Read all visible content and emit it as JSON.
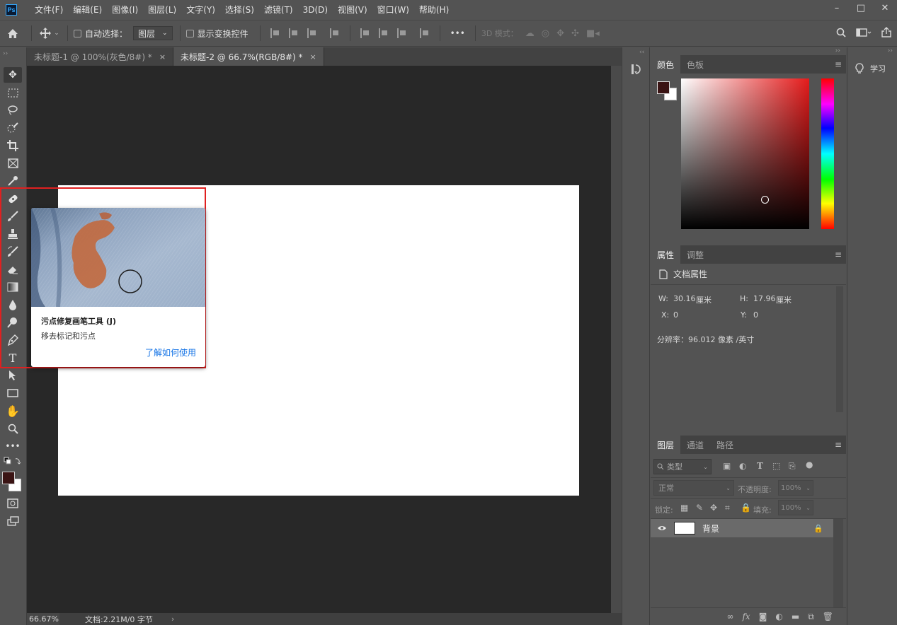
{
  "app": {
    "logo": "Ps",
    "menu": [
      "文件(F)",
      "编辑(E)",
      "图像(I)",
      "图层(L)",
      "文字(Y)",
      "选择(S)",
      "滤镜(T)",
      "3D(D)",
      "视图(V)",
      "窗口(W)",
      "帮助(H)"
    ],
    "window_buttons": [
      "–",
      "□",
      "✕"
    ]
  },
  "options_bar": {
    "auto_select_label": "自动选择：",
    "layer_dropdown": "图层",
    "show_transform_label": "显示变换控件",
    "more": "•••",
    "mode_3d_label": "3D 模式："
  },
  "tabs": [
    {
      "label": "未标题-1 @ 100%(灰色/8#) *",
      "close": "×"
    },
    {
      "label": "未标题-2 @ 66.7%(RGB/8#) *",
      "close": "×"
    }
  ],
  "toolbar": {
    "collapse": "››",
    "more": "•••"
  },
  "tooltip": {
    "title": "污点修复画笔工具 (J)",
    "description": "移去标记和污点",
    "link": "了解如何使用"
  },
  "status": {
    "zoom": "66.67%",
    "doc_info": "文档:2.21M/0 字节",
    "arrow": "›"
  },
  "color_panel": {
    "tabs": [
      "颜色",
      "色板"
    ],
    "foreground": "#3a1414",
    "background": "#ffffff"
  },
  "properties_panel": {
    "tabs": [
      "属性",
      "调整"
    ],
    "section": "文档属性",
    "w_label": "W:",
    "w_value": "30.16",
    "w_unit": "厘米",
    "h_label": "H:",
    "h_value": "17.96",
    "h_unit": "厘米",
    "x_label": "X:",
    "x_value": "0",
    "y_label": "Y:",
    "y_value": "0",
    "resolution": "分辨率：96.012 像素 /英寸"
  },
  "layers_panel": {
    "tabs": [
      "图层",
      "通道",
      "路径"
    ],
    "filter_kind": "类型",
    "blend_mode": "正常",
    "opacity_label": "不透明度:",
    "opacity_value": "100%",
    "lock_label": "锁定:",
    "fill_label": "填充:",
    "fill_value": "100%",
    "layers": [
      {
        "name": "背景"
      }
    ]
  },
  "learn": {
    "label": "学习"
  }
}
